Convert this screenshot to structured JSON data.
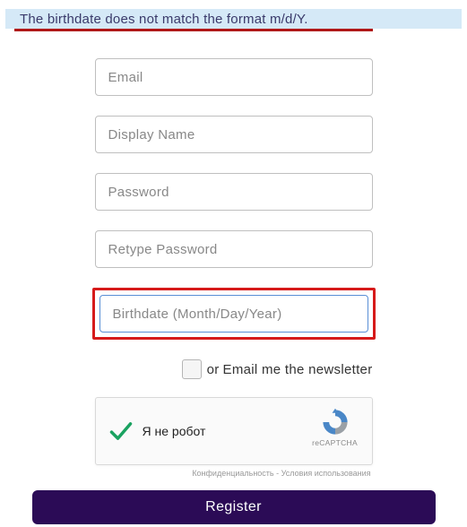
{
  "error": {
    "message": "The birthdate does not match the format m/d/Y."
  },
  "fields": {
    "email": {
      "placeholder": "Email"
    },
    "display_name": {
      "placeholder": "Display Name"
    },
    "password": {
      "placeholder": "Password"
    },
    "retype_password": {
      "placeholder": "Retype Password"
    },
    "birthdate": {
      "placeholder": "Birthdate (Month/Day/Year)"
    }
  },
  "newsletter": {
    "prefix": "or",
    "label": "Email me the newsletter"
  },
  "captcha": {
    "label": "Я не робот",
    "brand": "reCAPTCHA",
    "footer": "Конфиденциальность - Условия использования"
  },
  "actions": {
    "register": "Register"
  }
}
